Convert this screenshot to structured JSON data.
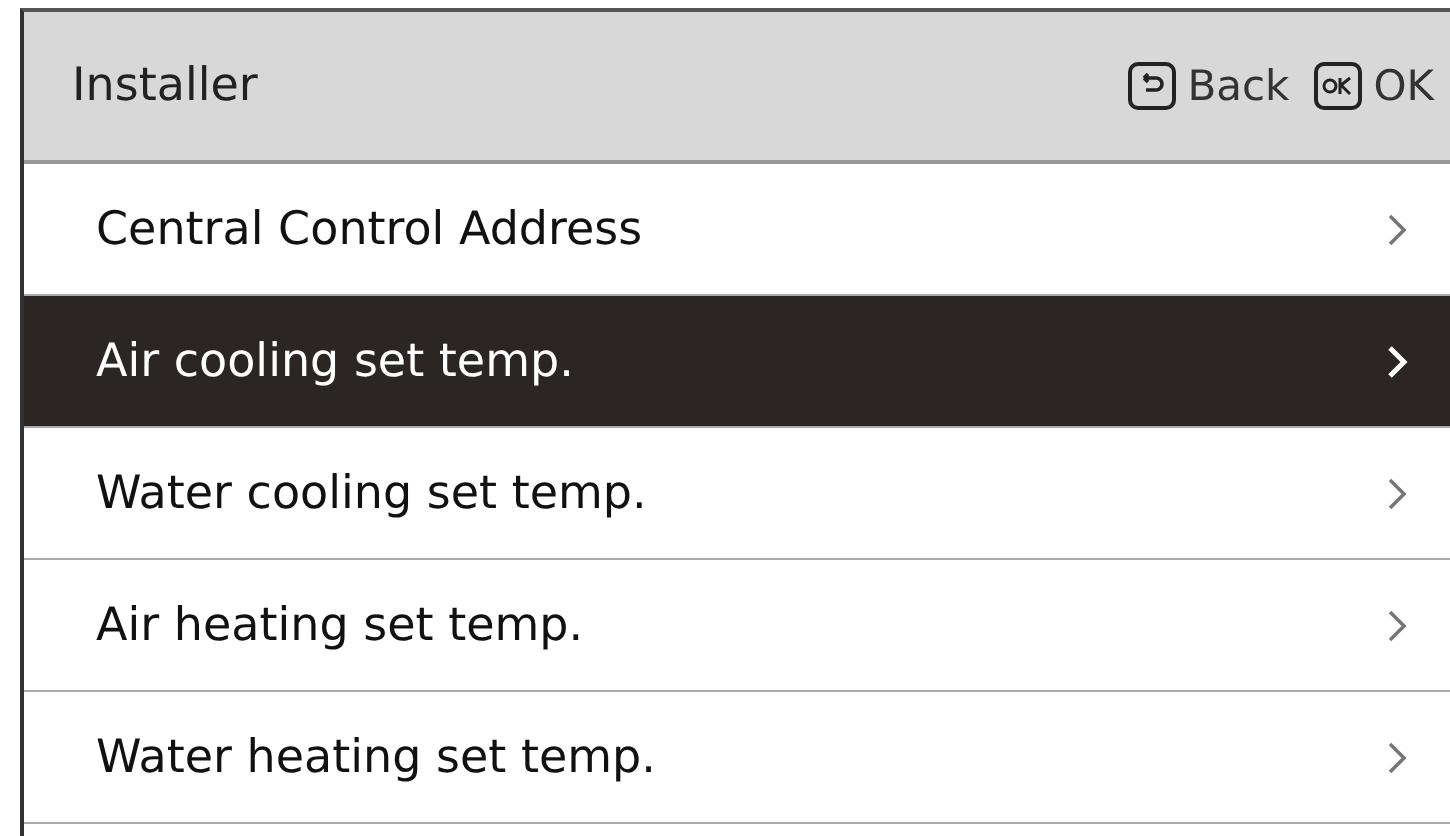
{
  "header": {
    "title": "Installer",
    "actions": [
      {
        "kind": "back",
        "label": "Back"
      },
      {
        "kind": "ok",
        "label": "OK"
      }
    ]
  },
  "menu": [
    {
      "label": "Central Control Address",
      "selected": false
    },
    {
      "label": "Air cooling set temp.",
      "selected": true
    },
    {
      "label": "Water cooling set temp.",
      "selected": false
    },
    {
      "label": "Air heating set temp.",
      "selected": false
    },
    {
      "label": "Water heating set temp.",
      "selected": false
    }
  ]
}
